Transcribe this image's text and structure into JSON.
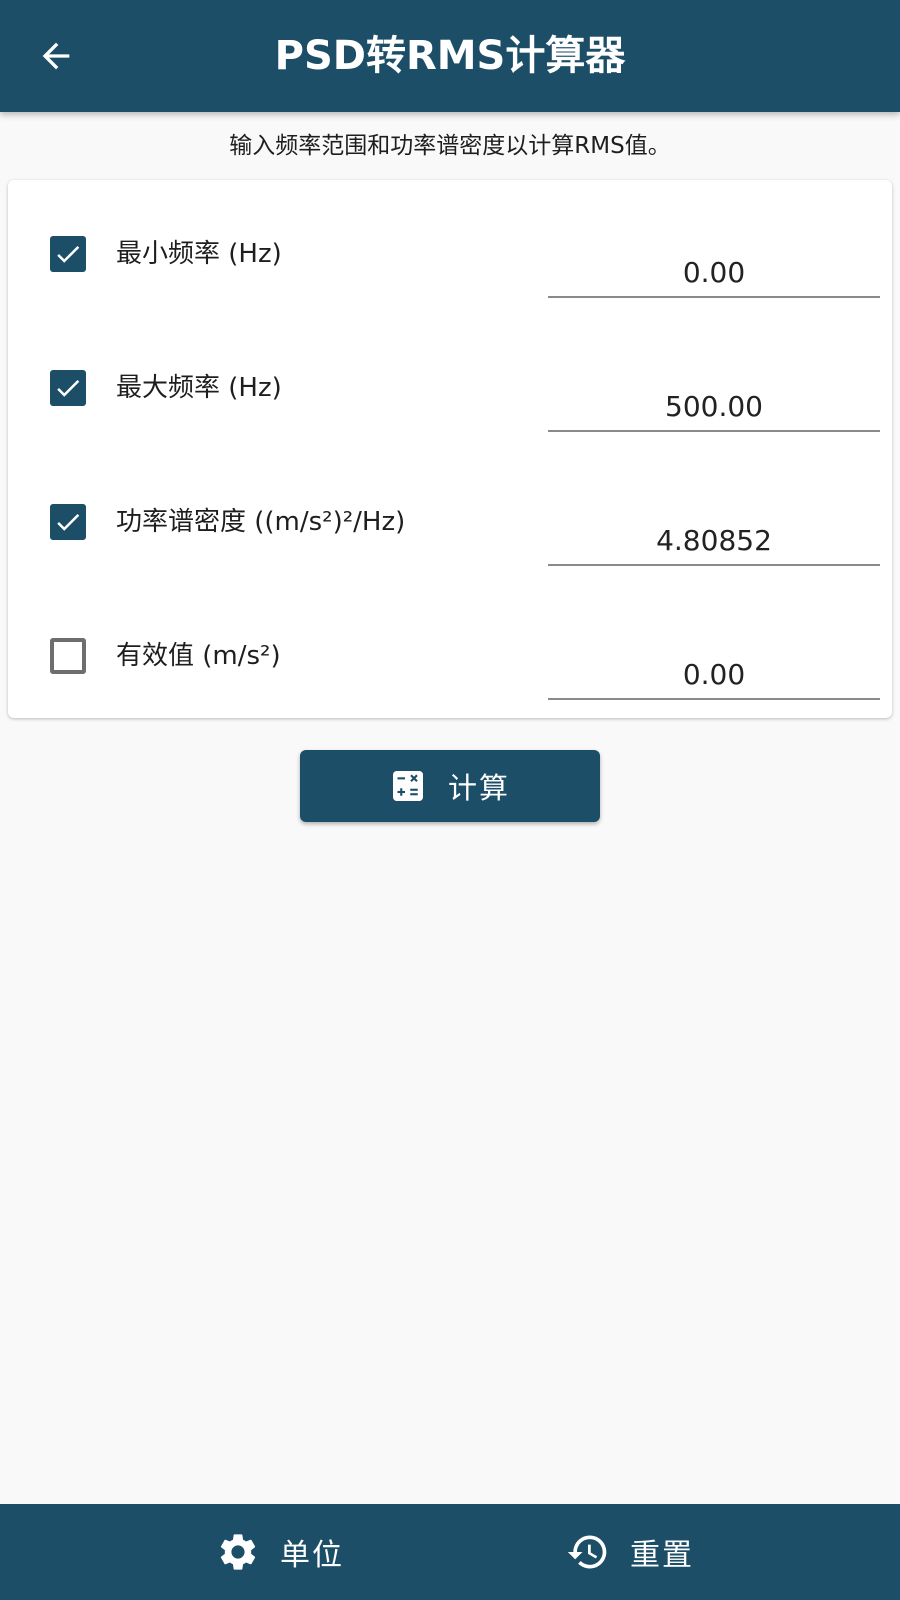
{
  "app_bar": {
    "title": "PSD转RMS计算器",
    "back_icon": "arrow-left-icon"
  },
  "subtitle": "输入频率范围和功率谱密度以计算RMS值。",
  "fields": [
    {
      "label": "最小频率 (Hz)",
      "value": "0.00",
      "checked": true
    },
    {
      "label": "最大频率 (Hz)",
      "value": "500.00",
      "checked": true
    },
    {
      "label": "功率谱密度 ((m/s²)²/Hz)",
      "value": "4.80852",
      "checked": true
    },
    {
      "label": "有效值 (m/s²)",
      "value": "0.00",
      "checked": false
    }
  ],
  "calculate_button": {
    "label": "计算",
    "icon": "calculator-icon"
  },
  "bottom_bar": {
    "units": {
      "label": "单位",
      "icon": "gear-icon"
    },
    "reset": {
      "label": "重置",
      "icon": "history-icon"
    }
  },
  "colors": {
    "primary": "#1d4e68",
    "background": "#f9f9f9",
    "card": "#ffffff"
  }
}
